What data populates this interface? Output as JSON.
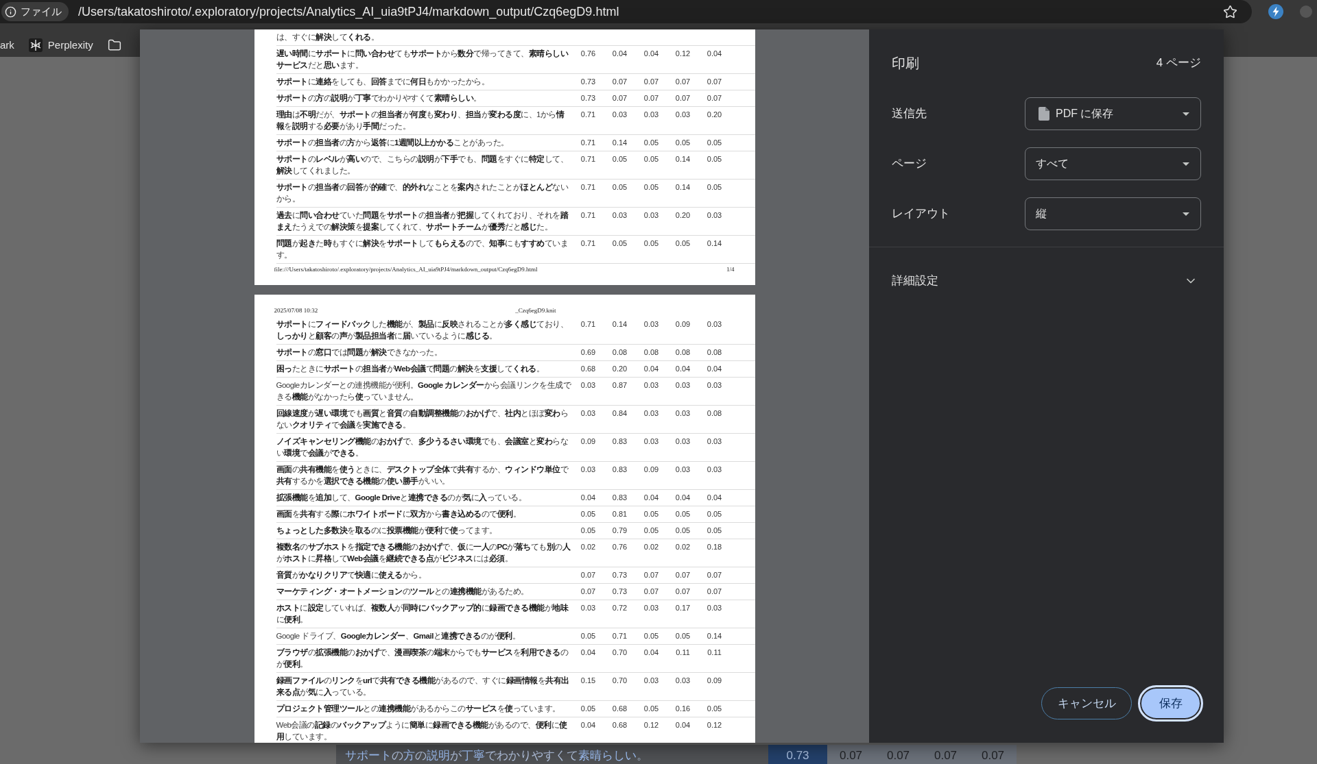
{
  "browser": {
    "site_chip": "ファイル",
    "url": "/Users/takatoshiroto/.exploratory/projects/Analytics_AI_uia9tPJ4/markdown_output/Czq6egD9.html",
    "bookmarks": [
      {
        "kind": "text",
        "label": "ark"
      },
      {
        "kind": "site",
        "label": "Perplexity"
      },
      {
        "kind": "folder"
      }
    ]
  },
  "print_preview": {
    "pages": [
      {
        "rows": [
          {
            "text": "は、すぐに**解決**して**くれる**。"
          },
          {
            "text": "**遅い時間**に**サポート**に**問い合わせ**ても**サポート**から**数分**で帰ってきて、**素晴らしいサービス**だと**思い**ます。",
            "values": [
              "0.76",
              "0.04",
              "0.04",
              "0.12",
              "0.04"
            ]
          },
          {
            "text": "**サポート**に**連絡**をしても、**回答**までに**何日**もかかったから。",
            "values": [
              "0.73",
              "0.07",
              "0.07",
              "0.07",
              "0.07"
            ]
          },
          {
            "text": "**サポート**の**方**の**説明**が**丁寧**でわかりやすくて**素晴らしい**。",
            "values": [
              "0.73",
              "0.07",
              "0.07",
              "0.07",
              "0.07"
            ]
          },
          {
            "text": "**理由**は**不明**だが、**サポート**の**担当者**が**何度**も**変わり**、**担当**が**変わる度**に、1から**情報**を**説明**する**必要**があり**手間**だった。",
            "values": [
              "0.71",
              "0.03",
              "0.03",
              "0.03",
              "0.20"
            ]
          },
          {
            "text": "**サポート**の**担当者**の**方**から**返答**に**1週間以上かかる**ことがあった。",
            "values": [
              "0.71",
              "0.14",
              "0.05",
              "0.05",
              "0.05"
            ]
          },
          {
            "text": "**サポート**の**レベル**が**高い**ので、こちらの**説明**が**下手**でも、**問題**をすぐに**特定**して、**解決**してくれました。",
            "values": [
              "0.71",
              "0.05",
              "0.05",
              "0.14",
              "0.05"
            ]
          },
          {
            "text": "**サポート**の**担当者**の**回答**が**的確**で、**的外れ**なことを**案内**されたことが**ほとんど**ないから。",
            "values": [
              "0.71",
              "0.05",
              "0.05",
              "0.14",
              "0.05"
            ]
          },
          {
            "text": "**過去**に**問い合わせ**ていた**問題**を**サポート**の**担当者**が**把握**してくれており、それを**踏まえ**たうえでの**解決策**を**提案**してくれて、**サポートチーム**が**優秀**だと**感じ**た。",
            "values": [
              "0.71",
              "0.03",
              "0.03",
              "0.20",
              "0.03"
            ]
          },
          {
            "text": "**問題**が**起き**た**時**もすぐに**解決**を**サポート**して**もらえる**ので、**知事**にも**すすめ**ています。",
            "values": [
              "0.71",
              "0.05",
              "0.05",
              "0.05",
              "0.14"
            ]
          }
        ],
        "footer": {
          "url": "file:///Users/takatoshiroto/.exploratory/projects/Analytics_AI_uia9tPJ4/markdown_output/Czq6egD9.html",
          "page_number": "1/4"
        }
      },
      {
        "header": {
          "date": "2025/07/08 10:32",
          "title": "_Czq6egD9.knit"
        },
        "rows": [
          {
            "text": "**サポート**に**フィードバック**した**機能**が、**製品**に**反映**されることが**多く感じ**ており、**しっかり**と**顧客**の**声**が**製品担当者**に**届**いているように**感じる**。",
            "values": [
              "0.71",
              "0.14",
              "0.03",
              "0.09",
              "0.03"
            ]
          },
          {
            "text": "**サポート**の**窓口**では**問題**が**解決**できなかった。",
            "values": [
              "0.69",
              "0.08",
              "0.08",
              "0.08",
              "0.08"
            ]
          },
          {
            "text": "**困っ**たときに**サポート**の**担当者**が**Web会議**で**問題**の**解決**を**支援**して**くれる**。",
            "values": [
              "0.68",
              "0.20",
              "0.04",
              "0.04",
              "0.04"
            ]
          },
          {
            "text": "Googleカレンダーとの連携機能が便利。**Google カレンダー**から会議リンクを生成できる**機能**がなかったら**使**っていません。",
            "values": [
              "0.03",
              "0.87",
              "0.03",
              "0.03",
              "0.03"
            ]
          },
          {
            "text": "**回線速度**が**遅い環境**でも**画質**と**音質**の**自動調整機能**の**おかげ**で、**社内**とほぼ**変わ**らない**クオリティ**で**会議**を**実施できる**。",
            "values": [
              "0.03",
              "0.84",
              "0.03",
              "0.03",
              "0.08"
            ]
          },
          {
            "text": "**ノイズキャンセリング機能**の**おかげ**で、**多少うるさい環境**でも、**会議室**と**変わ**らない**環境**で**会議**が**できる**。",
            "values": [
              "0.09",
              "0.83",
              "0.03",
              "0.03",
              "0.03"
            ]
          },
          {
            "text": "**画面**の**共有機能**を**使う**ときに、**デスクトップ全体**で**共有**するか、**ウィンドウ単位**で**共有**するかを**選択できる機能**の**使い勝手**がいい。",
            "values": [
              "0.03",
              "0.83",
              "0.09",
              "0.03",
              "0.03"
            ]
          },
          {
            "text": "**拡張機能**を**追加**して、**Google Drive**と**連携できる**のが**気**に**入**っている。",
            "values": [
              "0.04",
              "0.83",
              "0.04",
              "0.04",
              "0.04"
            ]
          },
          {
            "text": "**画面**を**共有**する**際**に**ホワイトボード**に**双方**から**書き込める**ので**便利**。",
            "values": [
              "0.05",
              "0.81",
              "0.05",
              "0.05",
              "0.05"
            ]
          },
          {
            "text": "**ちょっとした多数決**を**取る**のに**投票機能**が**便利**で**使**ってます。",
            "values": [
              "0.05",
              "0.79",
              "0.05",
              "0.05",
              "0.05"
            ]
          },
          {
            "text": "**複数名**の**サブホスト**を**指定できる機能**の**おかげ**で、**仮**に**一人**の**PC**が**落ち**ても**別**の**人**が**ホスト**に**昇格**して**Web会議**を**継続できる点**が**ビジネス**には**必須**。",
            "values": [
              "0.02",
              "0.76",
              "0.02",
              "0.02",
              "0.18"
            ]
          },
          {
            "text": "**音質**が**かなりクリア**で**快適**に**使える**から。",
            "values": [
              "0.07",
              "0.73",
              "0.07",
              "0.07",
              "0.07"
            ]
          },
          {
            "text": "**マーケティング・オートメーション**の**ツール**との**連携機能**があるため。",
            "values": [
              "0.07",
              "0.73",
              "0.07",
              "0.07",
              "0.07"
            ]
          },
          {
            "text": "**ホスト**に**設定**していれば、**複数人**が**同時にバックアップ的**に**録画できる機能**が**地味**に**便利**。",
            "values": [
              "0.03",
              "0.72",
              "0.03",
              "0.17",
              "0.03"
            ]
          },
          {
            "text": "Google ドライブ、**Googleカレンダー**、**Gmail**と**連携できる**のが**便利**。",
            "values": [
              "0.05",
              "0.71",
              "0.05",
              "0.05",
              "0.14"
            ]
          },
          {
            "text": "**ブラウザ**の**拡張機能**の**おかげ**で、**漫画喫茶**の**端末**からでも**サービス**を**利用できる**のが**便利**。",
            "values": [
              "0.04",
              "0.70",
              "0.04",
              "0.11",
              "0.11"
            ]
          },
          {
            "text": "**録画ファイル**の**リンク**を**url**で**共有できる機能**があるので、すぐに**録画情報**を**共有出来る点**が**気**に**入**っている。",
            "values": [
              "0.15",
              "0.70",
              "0.03",
              "0.03",
              "0.09"
            ]
          },
          {
            "text": "**プロジェクト管理ツール**との**連携機能**があるからこの**サービス**を**使**っています。",
            "values": [
              "0.05",
              "0.68",
              "0.05",
              "0.16",
              "0.05"
            ]
          },
          {
            "text": "Web会議の**記録**の**バックアップ**ように**簡単**に**録画できる機能**があるので、**便利**に**使用**しています。",
            "values": [
              "0.04",
              "0.68",
              "0.12",
              "0.04",
              "0.12"
            ]
          }
        ]
      }
    ]
  },
  "print_panel": {
    "title": "印刷",
    "page_count": "4 ページ",
    "settings": [
      {
        "kind": "destination",
        "label": "送信先",
        "value": "PDF に保存"
      },
      {
        "kind": "plain",
        "label": "ページ",
        "value": "すべて"
      },
      {
        "kind": "plain",
        "label": "レイアウト",
        "value": "縦"
      }
    ],
    "more_settings": {
      "label": "詳細設定",
      "expanded": false
    },
    "buttons": [
      {
        "kind": "secondary",
        "label": "キャンセル",
        "focused": false
      },
      {
        "kind": "primary",
        "label": "保存",
        "focused": true
      }
    ]
  },
  "background_page": {
    "row": {
      "text": "**サポート**の**方**の**説明**が**丁寧**でわかりやすくて**素晴らしい**。",
      "cells": [
        {
          "value": "0.73",
          "highlighted": true
        },
        {
          "value": "0.07",
          "highlighted": false
        },
        {
          "value": "0.07",
          "highlighted": false
        },
        {
          "value": "0.07",
          "highlighted": false
        },
        {
          "value": "0.07",
          "highlighted": false
        }
      ]
    }
  }
}
